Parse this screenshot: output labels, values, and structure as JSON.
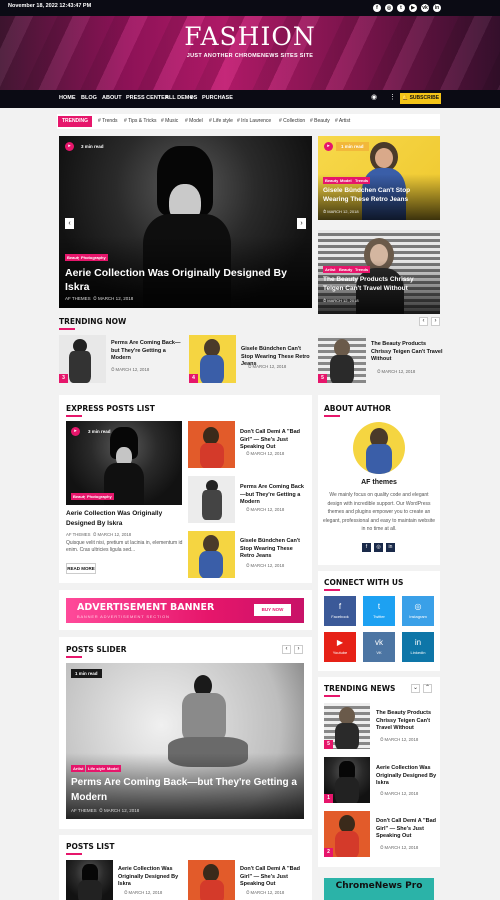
{
  "topbar": {
    "date": "November 18, 2022 12:43:47 PM",
    "social": [
      "f",
      "◎",
      "t",
      "▶",
      "vk",
      "in"
    ]
  },
  "site": {
    "title": "FASHION",
    "tagline": "JUST ANOTHER CHROMENEWS SITES SITE"
  },
  "nav": {
    "items": [
      "HOME",
      "BLOG",
      "ABOUT",
      "PRESS CENTER",
      "ALL DEMOS",
      "PURCHASE"
    ],
    "subscribe": "SUBSCRIBE"
  },
  "trending_bar": {
    "label": "TRENDING",
    "tags": [
      "Trends",
      "Tips & Tricks",
      "Music",
      "Model",
      "Life style",
      "Irís Lawrence",
      "Collection",
      "Beauty",
      "Artist"
    ]
  },
  "featured": {
    "main": {
      "readtime": "3 min read",
      "cats": [
        "Beauty",
        "Photography"
      ],
      "title": "Aerie Collection Was Originally Designed By Iskra",
      "author": "AF THEMES",
      "date": "MARCH 12, 2018"
    },
    "side1": {
      "readtime": "1 min read",
      "cats": [
        "Beauty",
        "Model",
        "Trends"
      ],
      "title": "Gisele Bündchen Can't Stop Wearing These Retro Jeans",
      "date": "MARCH 12, 2018"
    },
    "side2": {
      "cats": [
        "Artist",
        "Beauty",
        "Trends"
      ],
      "title": "The Beauty Products Chrissy Teigen Can't Travel Without",
      "date": "MARCH 12, 2018"
    }
  },
  "trending_now": {
    "heading": "TRENDING NOW",
    "items": [
      {
        "num": "3",
        "title": "Perms Are Coming Back—but They're Getting a Modern",
        "date": "MARCH 12, 2018"
      },
      {
        "num": "4",
        "title": "Gisele Bündchen Can't Stop Wearing These Retro Jeans",
        "date": "MARCH 12, 2018"
      },
      {
        "num": "5",
        "title": "The Beauty Products Chrissy Teigen Can't Travel Without",
        "date": "MARCH 12, 2018"
      }
    ]
  },
  "express": {
    "heading": "EXPRESS POSTS LIST",
    "main": {
      "readtime": "3 min read",
      "cats": [
        "Beauty",
        "Photography"
      ],
      "title": "Aerie Collection Was Originally Designed By Iskra",
      "author": "AF THEMES",
      "date": "MARCH 12, 2018",
      "excerpt": "Quisque velit nisi, pretium ut lacinia in, elementum id enim. Cras ultricies ligula sed...",
      "button": "READ MORE"
    },
    "list": [
      {
        "title": "Don't Call Demi A \"Bad Girl\" — She's Just Speaking Out",
        "date": "MARCH 12, 2018"
      },
      {
        "title": "Perms Are Coming Back—but They're Getting a Modern",
        "date": "MARCH 12, 2018"
      },
      {
        "title": "Gisele Bündchen Can't Stop Wearing These Retro Jeans",
        "date": "MARCH 12, 2018"
      }
    ]
  },
  "ad": {
    "title": "ADVERTISEMENT BANNER",
    "sub": "BANNER ADVERTISEMENT SECTION",
    "button": "BUY NOW"
  },
  "slider": {
    "heading": "POSTS SLIDER",
    "readtime": "1 min read",
    "cats": [
      "Artist",
      "Life style",
      "Model"
    ],
    "title": "Perms Are Coming Back—but They're Getting a Modern",
    "author": "AF THEMES",
    "date": "MARCH 12, 2018"
  },
  "posts_list": {
    "heading": "POSTS LIST",
    "items": [
      {
        "title": "Aerie Collection Was Originally Designed By Iskra",
        "date": "MARCH 12, 2018"
      },
      {
        "title": "Don't Call Demi A \"Bad Girl\" — She's Just Speaking Out",
        "date": "MARCH 12, 2018"
      }
    ]
  },
  "about": {
    "heading": "ABOUT AUTHOR",
    "name": "AF themes",
    "bio": "We mainly focus on quality code and elegant design with incredible support. Our WordPress themes and plugins empower you to create an elegant, professional and easy to maintain website in no time at all."
  },
  "connect": {
    "heading": "CONNECT WITH US",
    "items": [
      {
        "icon": "f",
        "name": "Facebook",
        "color": "#3b5998"
      },
      {
        "icon": "t",
        "name": "Twitter",
        "color": "#1da1f2"
      },
      {
        "icon": "◎",
        "name": "Instagram",
        "color": "#3aa0e8"
      },
      {
        "icon": "▶",
        "name": "Youtube",
        "color": "#e62117"
      },
      {
        "icon": "vk",
        "name": "VK",
        "color": "#4c75a3"
      },
      {
        "icon": "in",
        "name": "Linkedin",
        "color": "#0e76a8"
      }
    ]
  },
  "trending_news": {
    "heading": "TRENDING NEWS",
    "items": [
      {
        "num": "5",
        "title": "The Beauty Products Chrissy Teigen Can't Travel Without",
        "date": "MARCH 12, 2018"
      },
      {
        "num": "1",
        "title": "Aerie Collection Was Originally Designed By Iskra",
        "date": "MARCH 12, 2018"
      },
      {
        "num": "2",
        "title": "Don't Call Demi A \"Bad Girl\" — She's Just Speaking Out",
        "date": "MARCH 12, 2018"
      }
    ]
  },
  "promo": {
    "text": "ChromeNews Pro"
  },
  "colors": {
    "accent": "#e6166b",
    "nav": "#0b0b14",
    "subscribe": "#f5c518"
  }
}
